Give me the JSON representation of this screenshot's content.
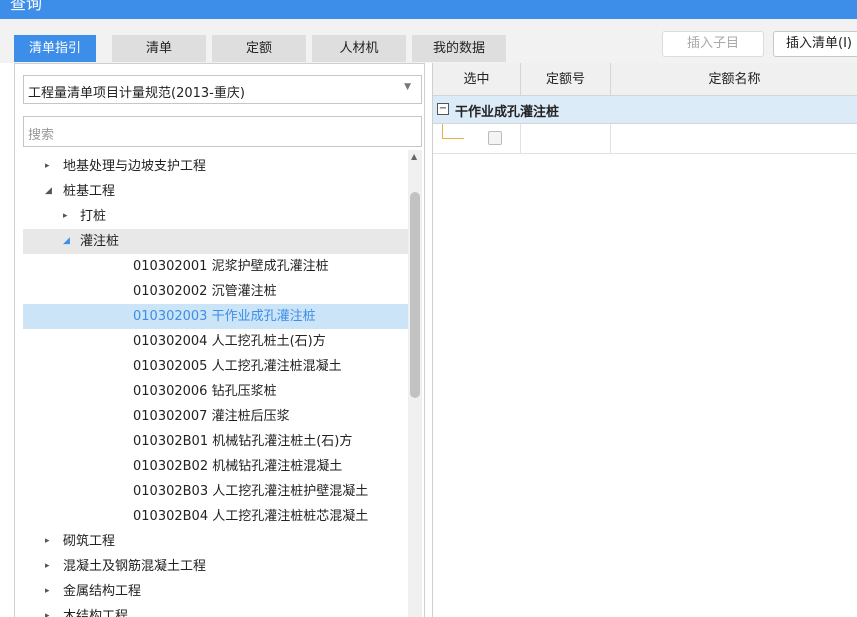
{
  "window": {
    "title": "查询"
  },
  "tabs": [
    {
      "label": "清单指引",
      "active": true
    },
    {
      "label": "清单"
    },
    {
      "label": "定额"
    },
    {
      "label": "人材机"
    },
    {
      "label": "我的数据"
    }
  ],
  "toolbar": {
    "insert_child_label": "插入子目",
    "insert_list_label": "插入清单(I)"
  },
  "left_panel": {
    "standard_select_value": "工程量清单项目计量规范(2013-重庆)",
    "search_placeholder": "搜索",
    "tree": [
      {
        "text": "地基处理与边坡支护工程",
        "arrow": "▸"
      },
      {
        "text": "桩基工程",
        "arrow": "◢"
      },
      {
        "text": "打桩",
        "arrow": "▸"
      },
      {
        "text": "灌注桩",
        "arrow": "◢"
      },
      {
        "text": "010302001  泥浆护壁成孔灌注桩",
        "arrow": ""
      },
      {
        "text": "010302002  沉管灌注桩",
        "arrow": ""
      },
      {
        "text": "010302003  干作业成孔灌注桩",
        "arrow": ""
      },
      {
        "text": "010302004  人工挖孔桩土(石)方",
        "arrow": ""
      },
      {
        "text": "010302005  人工挖孔灌注桩混凝土",
        "arrow": ""
      },
      {
        "text": "010302006  钻孔压浆桩",
        "arrow": ""
      },
      {
        "text": "010302007  灌注桩后压浆",
        "arrow": ""
      },
      {
        "text": "010302B01  机械钻孔灌注桩土(石)方",
        "arrow": ""
      },
      {
        "text": "010302B02  机械钻孔灌注桩混凝土",
        "arrow": ""
      },
      {
        "text": "010302B03  人工挖孔灌注桩护壁混凝土",
        "arrow": ""
      },
      {
        "text": "010302B04  人工挖孔灌注桩桩芯混凝土",
        "arrow": ""
      },
      {
        "text": "砌筑工程",
        "arrow": "▸"
      },
      {
        "text": "混凝土及钢筋混凝土工程",
        "arrow": "▸"
      },
      {
        "text": "金属结构工程",
        "arrow": "▸"
      },
      {
        "text": "木结构工程",
        "arrow": "▸"
      }
    ]
  },
  "grid": {
    "columns": [
      "选中",
      "定额号",
      "定额名称"
    ],
    "group_label": "干作业成孔灌注桩"
  },
  "colors": {
    "accent": "#3d8ee8",
    "selected_row_bg": "#cce4f7",
    "group_row_bg": "#dcebf8"
  }
}
